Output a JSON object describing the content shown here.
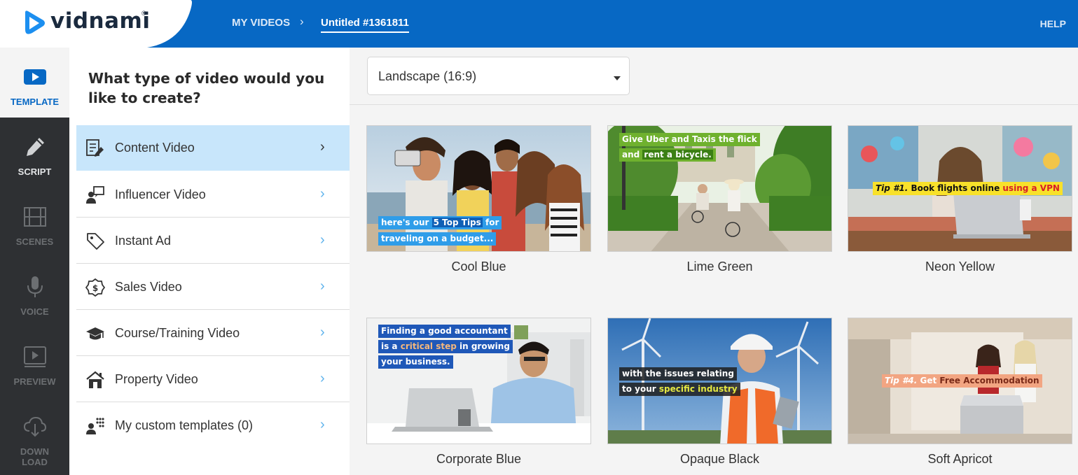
{
  "header": {
    "logo_text": "vidnami",
    "logo_reg": "®",
    "crumb_my_videos": "MY VIDEOS",
    "crumb_sep": "›",
    "crumb_current": "Untitled #1361811",
    "help": "HELP"
  },
  "rail": {
    "template": "TEMPLATE",
    "script": "SCRIPT",
    "scenes": "SCENES",
    "voice": "VOICE",
    "preview": "PREVIEW",
    "download_1": "DOWN",
    "download_2": "LOAD"
  },
  "panel": {
    "title": "What type of video would you like to create?",
    "items": [
      {
        "label": "Content Video"
      },
      {
        "label": "Influencer Video"
      },
      {
        "label": "Instant Ad"
      },
      {
        "label": "Sales Video"
      },
      {
        "label": "Course/Training Video"
      },
      {
        "label": "Property Video"
      },
      {
        "label": "My custom templates (0)"
      }
    ],
    "chevron": "›"
  },
  "toolbar": {
    "aspect_value": "Landscape (16:9)"
  },
  "templates": [
    {
      "name": "Cool Blue",
      "caption_1a": "here's our ",
      "caption_1b": "5 Top Tips",
      "caption_1c": " for",
      "caption_2": "traveling on a budget..."
    },
    {
      "name": "Lime Green",
      "caption_1": "Give Uber and Taxis the flick",
      "caption_2a": "and ",
      "caption_2b": "rent a bicycle."
    },
    {
      "name": "Neon Yellow",
      "caption_1a": "Tip #1. ",
      "caption_1b": "Book flights online ",
      "caption_1c": "using a VPN"
    },
    {
      "name": "Corporate Blue",
      "caption_1": "Finding a good accountant",
      "caption_2a": "is a ",
      "caption_2b": "critical step",
      "caption_2c": " in growing",
      "caption_3": "your business."
    },
    {
      "name": "Opaque Black",
      "caption_1": "with the issues relating",
      "caption_2a": "to your ",
      "caption_2b": "specific industry"
    },
    {
      "name": "Soft Apricot",
      "caption_1a": "Tip #4. ",
      "caption_1b": "Get ",
      "caption_1c": "Free Accommodation"
    }
  ],
  "colors": {
    "brand_blue": "#0768c4",
    "rail_dark": "#2e3033",
    "active_item": "#c8e6fb",
    "chevron_blue": "#5fb3ec"
  }
}
